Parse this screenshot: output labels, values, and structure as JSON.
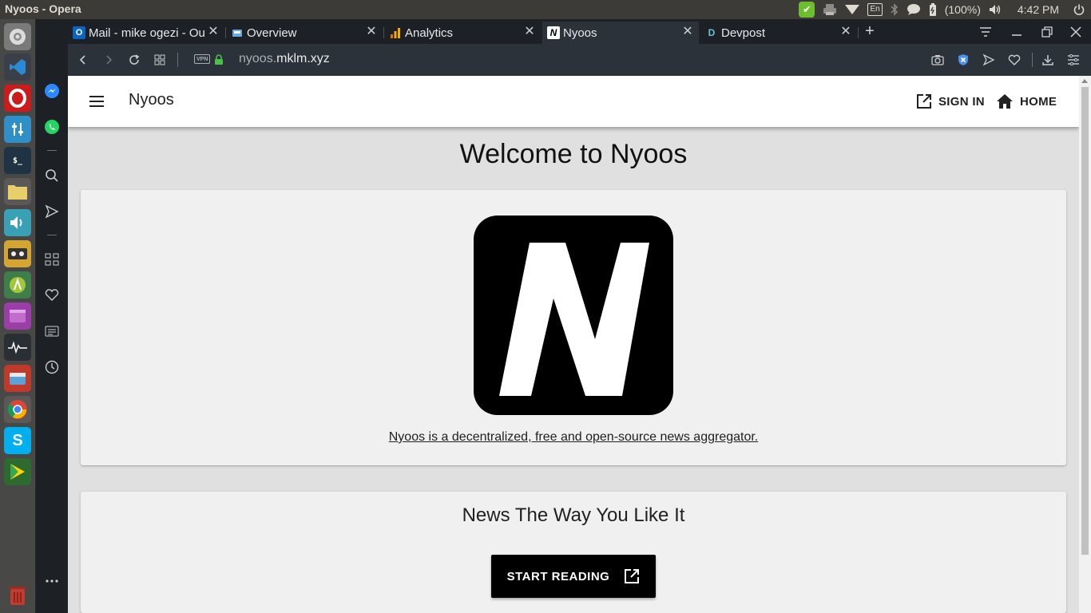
{
  "system": {
    "window_title": "Nyoos - Opera",
    "tray": {
      "lang": "En",
      "battery": "(100%)",
      "time": "4:42 PM"
    }
  },
  "tabs": [
    {
      "label": "Mail - mike ogezi - Ou",
      "favicon": "outlook-icon"
    },
    {
      "label": "Overview",
      "favicon": "dev-dashboard-icon"
    },
    {
      "label": "Analytics",
      "favicon": "analytics-icon"
    },
    {
      "label": "Nyoos",
      "favicon": "nyoos-icon"
    },
    {
      "label": "Devpost",
      "favicon": "devpost-icon"
    }
  ],
  "address": {
    "vpn": "VPN",
    "url_prefix": "nyoos.",
    "url_domain": "mklm.xyz"
  },
  "page": {
    "brand": "Nyoos",
    "sign_in": "SIGN IN",
    "home": "HOME",
    "welcome": "Welcome to Nyoos",
    "logo_letter": "N",
    "tagline": "Nyoos is a decentralized, free and open-source news aggregator.",
    "card2_title": "News The Way You Like It",
    "start_reading": "START READING"
  },
  "colors": {
    "page_bg": "#e0e0e0",
    "card_bg": "#f0f0f0",
    "button_bg": "#000000",
    "opera_dark": "#1d2126"
  }
}
